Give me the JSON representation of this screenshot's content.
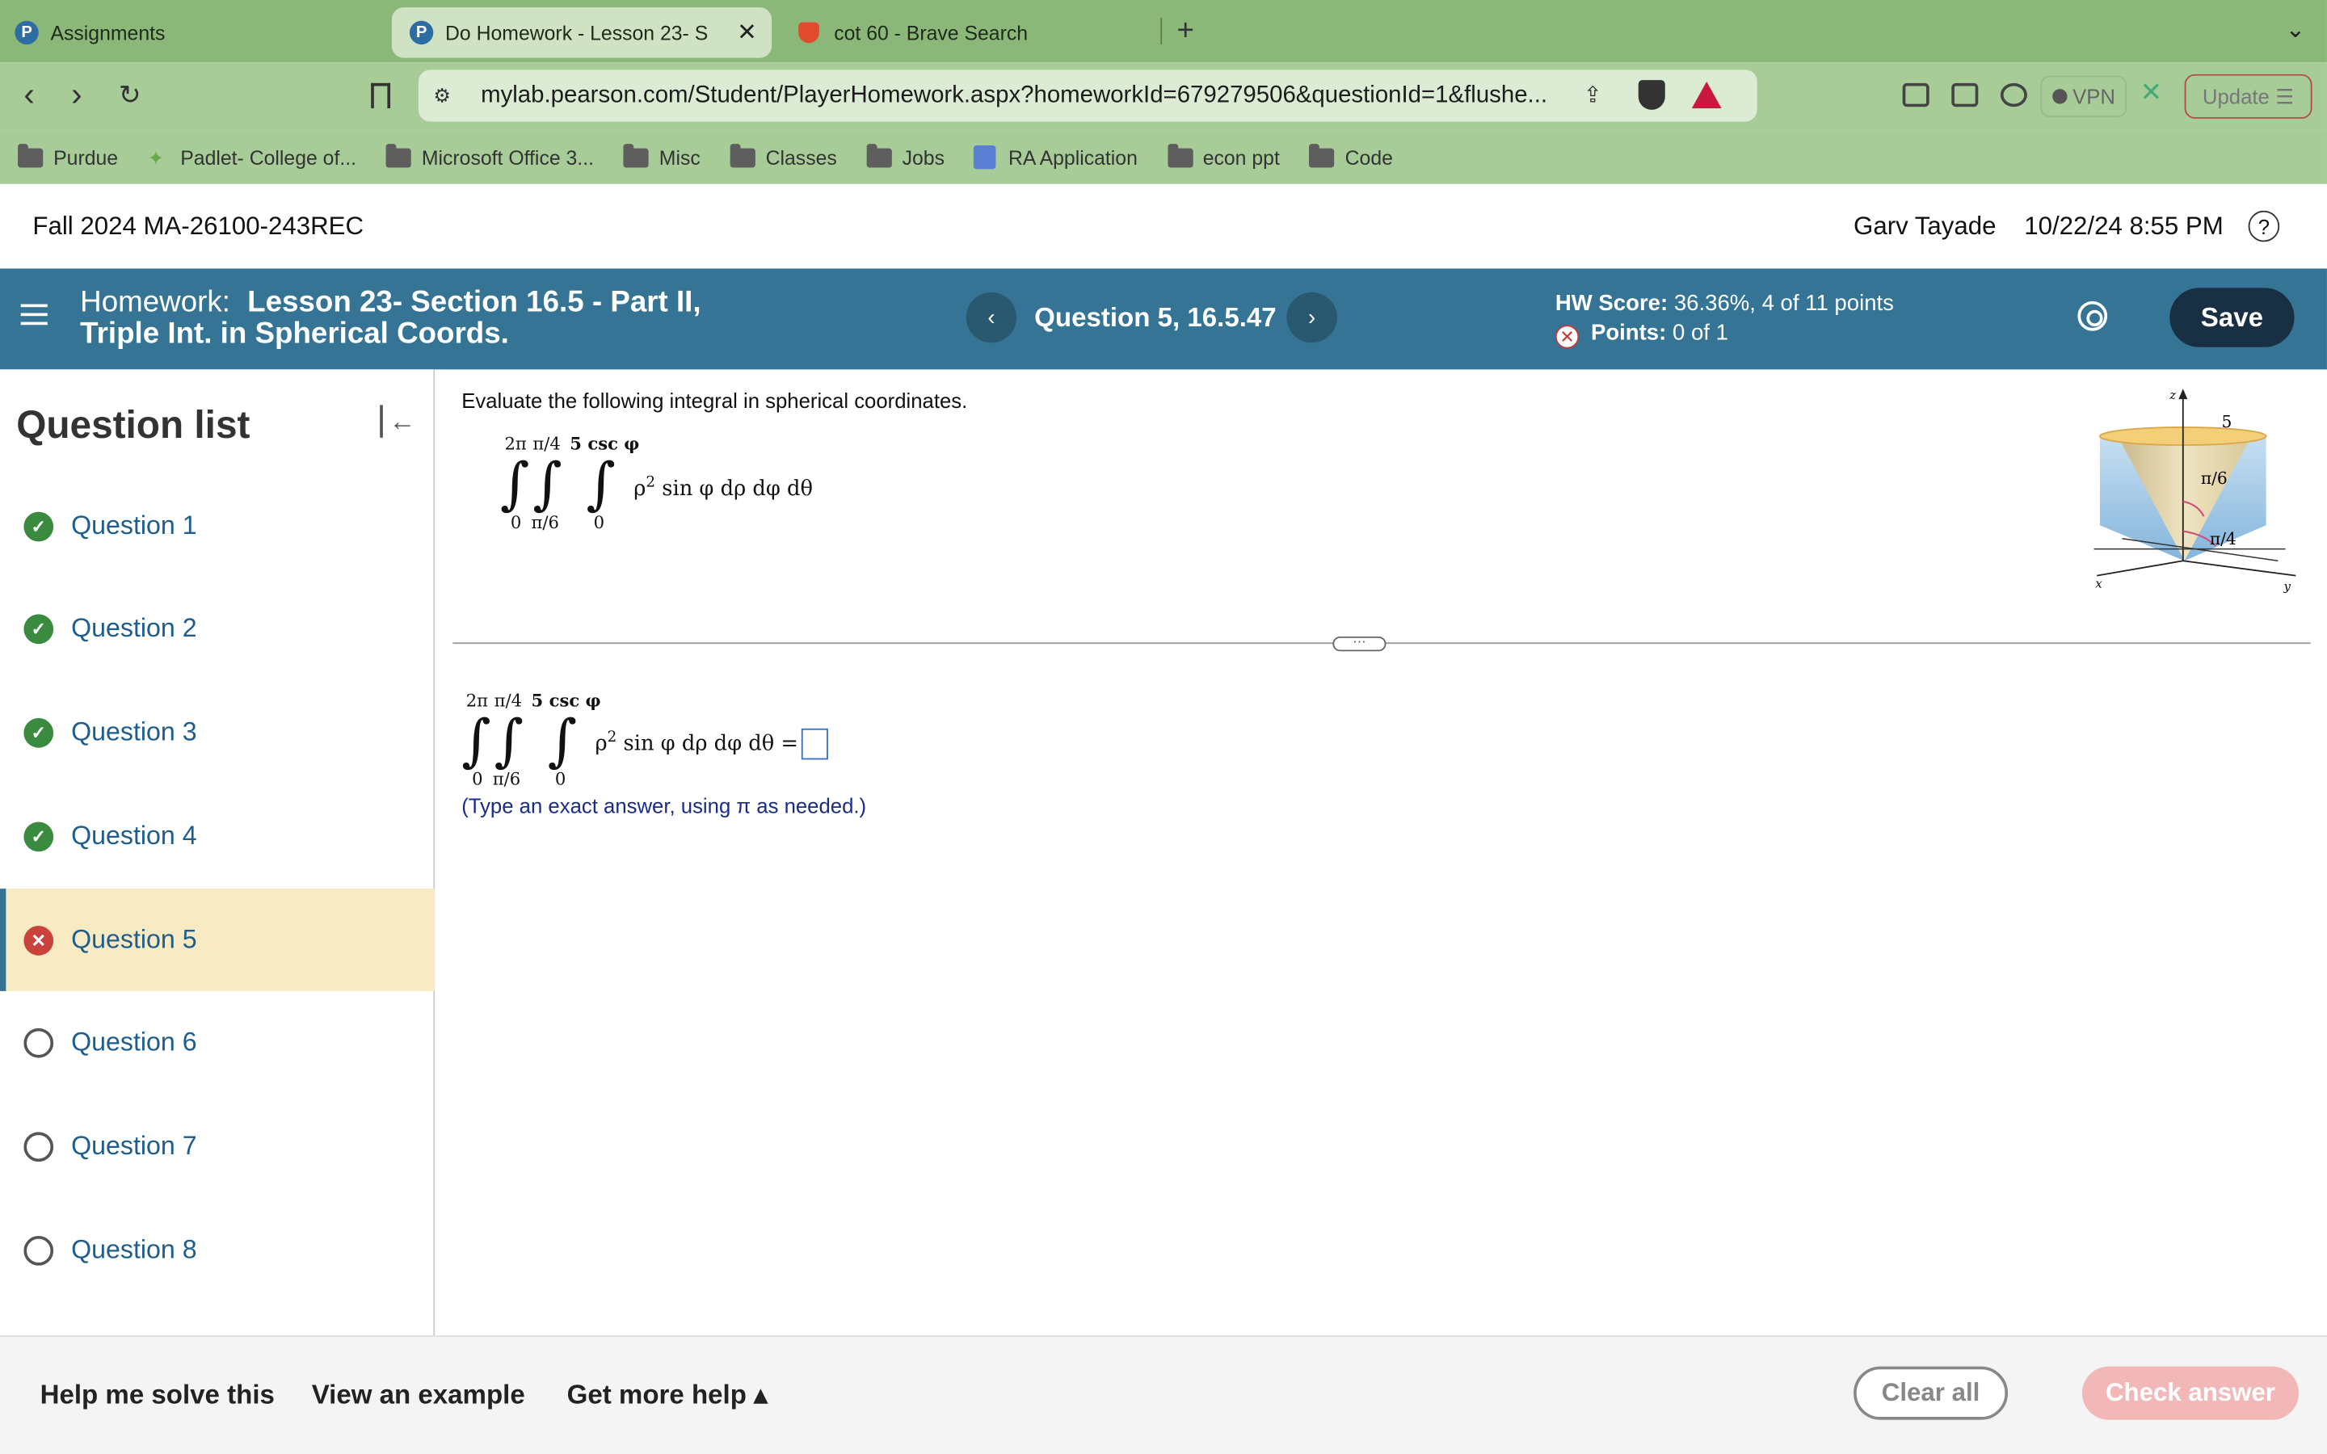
{
  "browser": {
    "tabs": [
      {
        "title": "Assignments",
        "active": false
      },
      {
        "title": "Do Homework - Lesson 23- S",
        "active": true
      },
      {
        "title": "cot 60 - Brave Search",
        "active": false
      }
    ],
    "new_tab": "+",
    "url": "mylab.pearson.com/Student/PlayerHomework.aspx?homeworkId=679279506&questionId=1&flushe...",
    "vpn_label": "VPN",
    "update_label": "Update",
    "bookmarks": [
      {
        "label": "Purdue",
        "icon": "folder-icon"
      },
      {
        "label": "Padlet- College of...",
        "icon": "padlet-icon"
      },
      {
        "label": "Microsoft Office 3...",
        "icon": "folder-icon"
      },
      {
        "label": "Misc",
        "icon": "folder-icon"
      },
      {
        "label": "Classes",
        "icon": "folder-icon"
      },
      {
        "label": "Jobs",
        "icon": "folder-icon"
      },
      {
        "label": "RA Application",
        "icon": "doc-icon"
      },
      {
        "label": "econ ppt",
        "icon": "folder-icon"
      },
      {
        "label": "Code",
        "icon": "folder-icon"
      }
    ]
  },
  "header": {
    "course": "Fall 2024 MA-26100-243REC",
    "user": "Garv Tayade",
    "datetime": "10/22/24 8:55 PM",
    "help": "?"
  },
  "hwbar": {
    "prefix": "Homework:",
    "title_line1": "Lesson 23- Section 16.5 - Part II,",
    "title_line2": "Triple Int. in Spherical Coords.",
    "question_label": "Question 5, 16.5.47",
    "score_label": "HW Score:",
    "score_value": "36.36%, 4 of 11 points",
    "points_label": "Points:",
    "points_value": "0 of 1",
    "save": "Save",
    "colors": {
      "bar": "#357495",
      "save": "#192f44"
    }
  },
  "sidebar": {
    "title": "Question list",
    "items": [
      {
        "label": "Question 1",
        "status": "done"
      },
      {
        "label": "Question 2",
        "status": "done"
      },
      {
        "label": "Question 3",
        "status": "done"
      },
      {
        "label": "Question 4",
        "status": "done"
      },
      {
        "label": "Question 5",
        "status": "wrong"
      },
      {
        "label": "Question 6",
        "status": "todo"
      },
      {
        "label": "Question 7",
        "status": "todo"
      },
      {
        "label": "Question 8",
        "status": "todo"
      }
    ]
  },
  "question": {
    "prompt": "Evaluate the following integral in spherical coordinates.",
    "limits_upper": [
      "2π",
      "π/4",
      "5 csc φ"
    ],
    "limits_lower": [
      "0",
      "π/6",
      "0"
    ],
    "integrand": "ρ",
    "integrand_exp": "2",
    "integrand_rest": " sin φ dρ dφ dθ",
    "equals": "=",
    "hint": "(Type an exact answer, using π as needed.)",
    "figure": {
      "axis_z": "z",
      "axis_x": "x",
      "axis_y": "y",
      "label_height": "5",
      "label_angle1": "π/6",
      "label_angle2": "π/4"
    }
  },
  "footer": {
    "help_solve": "Help me solve this",
    "view_example": "View an example",
    "more_help": "Get more help ▴",
    "clear_all": "Clear all",
    "check_answer": "Check answer"
  }
}
